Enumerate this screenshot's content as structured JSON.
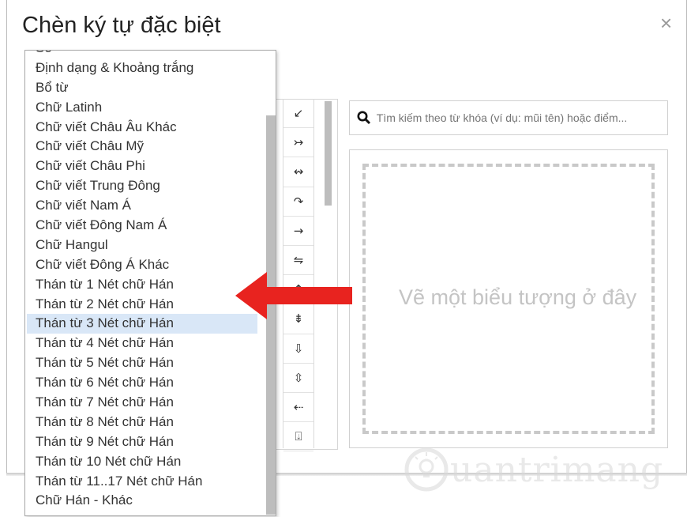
{
  "dialog": {
    "title": "Chèn ký tự đặc biệt",
    "close_label": "×"
  },
  "dropdown": {
    "items": [
      {
        "label": "Số"
      },
      {
        "label": "Định dạng & Khoảng trắng"
      },
      {
        "label": "Bổ từ"
      },
      {
        "label": "Chữ Latinh"
      },
      {
        "label": "Chữ viết Châu Âu Khác"
      },
      {
        "label": "Chữ viết Châu Mỹ"
      },
      {
        "label": "Chữ viết Châu Phi"
      },
      {
        "label": "Chữ viết Trung Đông"
      },
      {
        "label": "Chữ viết Nam Á"
      },
      {
        "label": "Chữ viết Đông Nam Á"
      },
      {
        "label": "Chữ Hangul"
      },
      {
        "label": "Chữ viết Đông Á Khác"
      },
      {
        "label": "Thán từ 1 Nét chữ Hán"
      },
      {
        "label": "Thán từ 2 Nét chữ Hán"
      },
      {
        "label": "Thán từ 3 Nét chữ Hán"
      },
      {
        "label": "Thán từ 4 Nét chữ Hán"
      },
      {
        "label": "Thán từ 5 Nét chữ Hán"
      },
      {
        "label": "Thán từ 6 Nét chữ Hán"
      },
      {
        "label": "Thán từ 7 Nét chữ Hán"
      },
      {
        "label": "Thán từ 8 Nét chữ Hán"
      },
      {
        "label": "Thán từ 9 Nét chữ Hán"
      },
      {
        "label": "Thán từ 10 Nét chữ Hán"
      },
      {
        "label": "Thán từ 11..17 Nét chữ Hán"
      },
      {
        "label": "Chữ Hán - Khác"
      }
    ],
    "selected_index": 14
  },
  "symbol_grid": {
    "symbols": [
      "↙",
      "↣",
      "↭",
      "↷",
      "→",
      "⇋",
      "⇞",
      "⇟",
      "⇩",
      "⇳",
      "⇠",
      "⍗"
    ]
  },
  "search": {
    "placeholder": "Tìm kiếm theo từ khóa (ví dụ: mũi tên) hoặc điểm..."
  },
  "draw": {
    "hint": "Vẽ một biểu tượng ở đây"
  },
  "watermark": {
    "text": "uantrimang"
  },
  "colors": {
    "selected_bg": "#d9e7f7",
    "arrow_red": "#e8231f"
  }
}
